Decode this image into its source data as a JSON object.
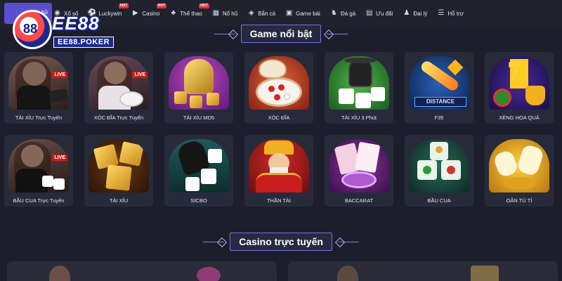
{
  "nav": {
    "home_label": "hủ",
    "items": [
      {
        "label": "Xổ số",
        "icon": "lottery-icon",
        "hot": ""
      },
      {
        "label": "Luckywin",
        "icon": "soccer-ball-icon",
        "hot": "HOT"
      },
      {
        "label": "Casino",
        "icon": "play-icon",
        "hot": "HOT"
      },
      {
        "label": "Thể thao",
        "icon": "sports-icon",
        "hot": "HOT"
      },
      {
        "label": "Nổ hũ",
        "icon": "slot-icon",
        "hot": ""
      },
      {
        "label": "Bắn cá",
        "icon": "fish-icon",
        "hot": ""
      },
      {
        "label": "Game bài",
        "icon": "gamepad-icon",
        "hot": ""
      },
      {
        "label": "Đá gà",
        "icon": "rooster-icon",
        "hot": ""
      },
      {
        "label": "Ưu đãi",
        "icon": "gift-icon",
        "hot": ""
      },
      {
        "label": "Đại lý",
        "icon": "agent-icon",
        "hot": ""
      },
      {
        "label": "Hỗ trợ",
        "icon": "support-icon",
        "hot": ""
      }
    ]
  },
  "logo": {
    "main": "EE88",
    "sub": "EE88.POKER",
    "badge": "88"
  },
  "sections": {
    "featured_title": "Game nổi bật",
    "casino_title": "Casino trực tuyến"
  },
  "games_row1": [
    {
      "label": "TÀI XỈU Trực Tuyến",
      "live": "LIVE"
    },
    {
      "label": "XÓC ĐĨA Trực Tuyến",
      "live": "LIVE"
    },
    {
      "label": "TÀI XỈU MD5",
      "live": ""
    },
    {
      "label": "XÓC ĐĨA",
      "live": ""
    },
    {
      "label": "TÀI XỈU 3 Phút",
      "live": ""
    },
    {
      "label": "F35",
      "live": "",
      "badge": "DISTANCE"
    },
    {
      "label": "XÈNG HOA QUẢ",
      "live": ""
    }
  ],
  "games_row2": [
    {
      "label": "BẦU CUA Trực Tuyến",
      "live": "LIVE"
    },
    {
      "label": "TÀI XỈU",
      "live": ""
    },
    {
      "label": "SICBO",
      "live": ""
    },
    {
      "label": "THẦN TÀI",
      "live": ""
    },
    {
      "label": "BACCARAT",
      "live": ""
    },
    {
      "label": "BẦU CUA",
      "live": ""
    },
    {
      "label": "OẲN TÙ TÌ",
      "live": ""
    }
  ],
  "colors": {
    "background": "#1c1f2b",
    "nav": "#20222e",
    "accent": "#5a4fd0",
    "card": "#272a39",
    "live": "#d21a1a"
  }
}
